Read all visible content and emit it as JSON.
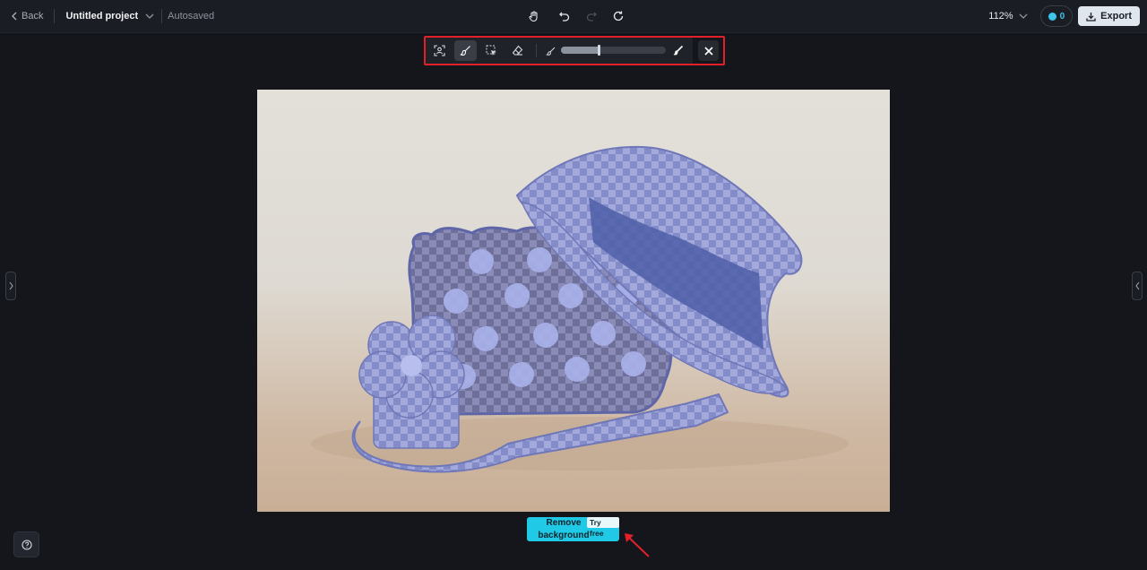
{
  "header": {
    "back_label": "Back",
    "project_title": "Untitled project",
    "save_status": "Autosaved",
    "zoom_level": "112%",
    "credits_count": "0",
    "export_label": "Export"
  },
  "toolbar": {
    "tools": [
      "select-subject-icon",
      "brush-icon",
      "smart-select-icon",
      "eraser-icon"
    ],
    "active_tool": "brush-icon",
    "brush_size_fraction": 0.36
  },
  "colors": {
    "accent": "#20c9e6",
    "highlight_border": "#e2202a",
    "mask": "#8b93d3"
  },
  "action": {
    "primary_label": "Remove background",
    "badge_label": "Try free"
  }
}
